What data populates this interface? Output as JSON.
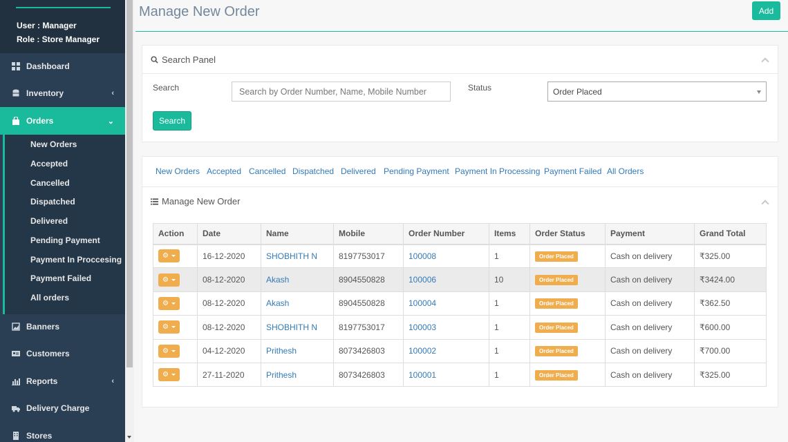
{
  "sidebar": {
    "user": "User : Manager",
    "role": "Role : Store Manager",
    "items": [
      {
        "label": "Dashboard",
        "icon": "dashboard-icon"
      },
      {
        "label": "Inventory",
        "icon": "database-icon"
      },
      {
        "label": "Orders",
        "icon": "shopping-bag-icon"
      },
      {
        "label": "Banners",
        "icon": "image-icon"
      },
      {
        "label": "Customers",
        "icon": "id-card-icon"
      },
      {
        "label": "Reports",
        "icon": "bar-chart-icon"
      },
      {
        "label": "Delivery Charge",
        "icon": "truck-icon"
      },
      {
        "label": "Stores",
        "icon": "building-icon"
      }
    ],
    "order_subitems": [
      "New Orders",
      "Accepted",
      "Cancelled",
      "Dispatched",
      "Delivered",
      "Pending Payment",
      "Payment In Proccesing",
      "Payment Failed",
      "All orders"
    ]
  },
  "header": {
    "title": "Manage New Order",
    "add_label": "Add"
  },
  "search_panel": {
    "title": "Search Panel",
    "search_label": "Search",
    "search_placeholder": "Search by Order Number, Name, Mobile Number",
    "status_label": "Status",
    "status_value": "Order Placed",
    "search_button": "Search"
  },
  "tabs": [
    "New Orders",
    "Accepted",
    "Cancelled",
    "Dispatched",
    "Delivered",
    "Pending Payment",
    "Payment In Processing",
    "Payment Failed",
    "All Orders"
  ],
  "orders_panel": {
    "title": "Manage New Order",
    "columns": [
      "Action",
      "Date",
      "Name",
      "Mobile",
      "Order Number",
      "Items",
      "Order Status",
      "Payment",
      "Grand Total"
    ],
    "rows": [
      {
        "date": "16-12-2020",
        "name": "SHOBHITH N",
        "mobile": "8197753017",
        "order": "100008",
        "items": "1",
        "status": "Order Placed",
        "payment": "Cash on delivery",
        "total": "₹325.00"
      },
      {
        "date": "08-12-2020",
        "name": "Akash",
        "mobile": "8904550828",
        "order": "100006",
        "items": "10",
        "status": "Order Placed",
        "payment": "Cash on delivery",
        "total": "₹3424.00"
      },
      {
        "date": "08-12-2020",
        "name": "Akash",
        "mobile": "8904550828",
        "order": "100004",
        "items": "1",
        "status": "Order Placed",
        "payment": "Cash on delivery",
        "total": "₹362.50"
      },
      {
        "date": "08-12-2020",
        "name": "SHOBHITH N",
        "mobile": "8197753017",
        "order": "100003",
        "items": "1",
        "status": "Order Placed",
        "payment": "Cash on delivery",
        "total": "₹600.00"
      },
      {
        "date": "04-12-2020",
        "name": "Prithesh",
        "mobile": "8073426803",
        "order": "100002",
        "items": "1",
        "status": "Order Placed",
        "payment": "Cash on delivery",
        "total": "₹700.00"
      },
      {
        "date": "27-11-2020",
        "name": "Prithesh",
        "mobile": "8073426803",
        "order": "100001",
        "items": "1",
        "status": "Order Placed",
        "payment": "Cash on delivery",
        "total": "₹325.00"
      }
    ]
  },
  "colors": {
    "accent": "#1abb9c",
    "sidebar": "#2a3f54",
    "warning": "#f0ad4e",
    "link": "#337ab7"
  }
}
